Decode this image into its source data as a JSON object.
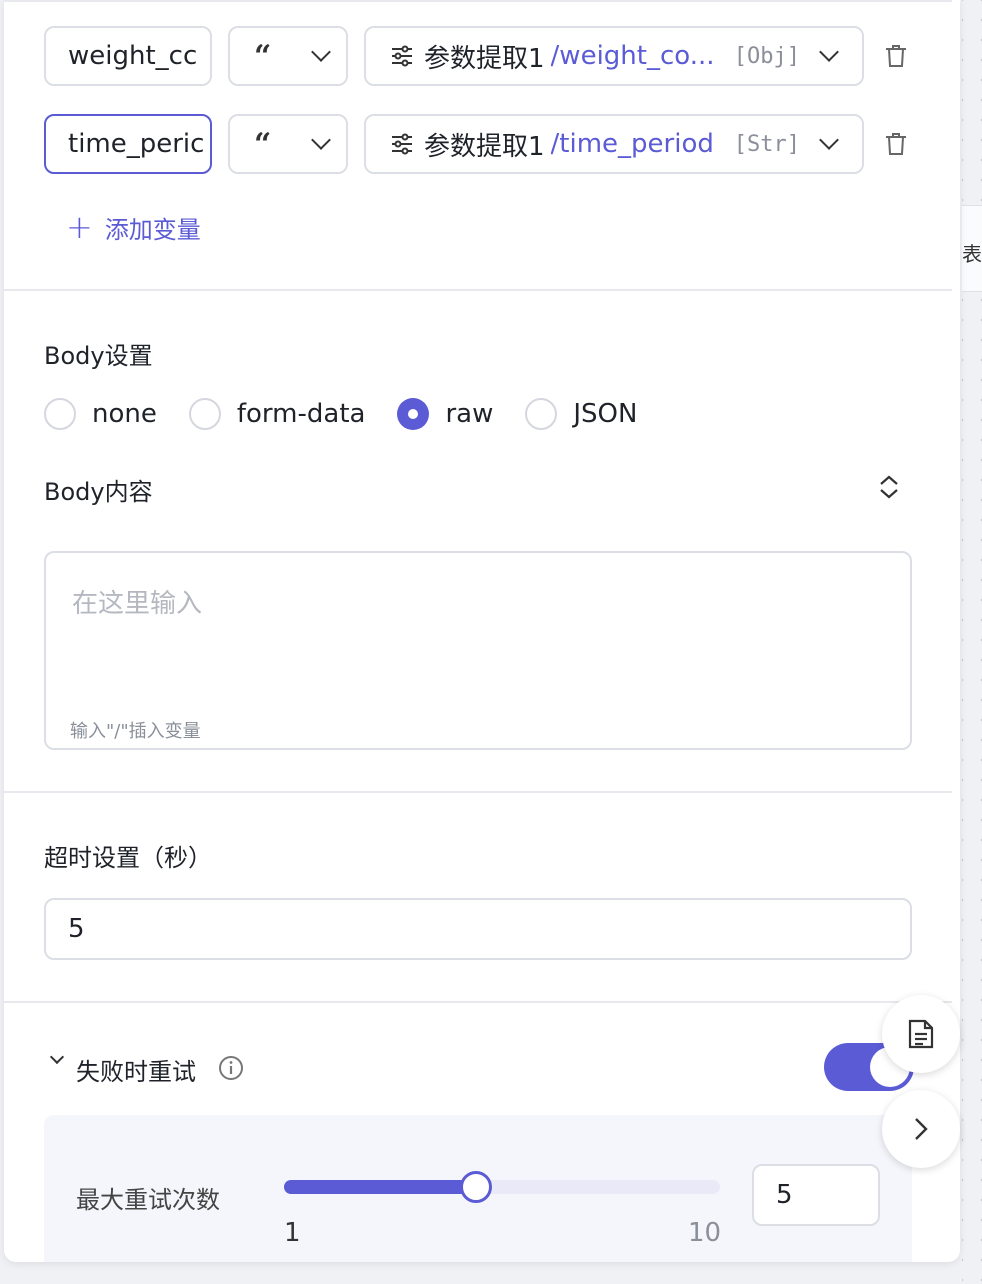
{
  "variables": [
    {
      "name": "weight_cc",
      "type_icon": "quote-icon",
      "source_label": "参数提取1",
      "source_path": "/weight_co...",
      "source_type": "[Obj]"
    },
    {
      "name": "time_peric",
      "type_icon": "quote-icon",
      "source_label": "参数提取1",
      "source_path": "/time_period",
      "source_type": "[Str]"
    }
  ],
  "add_variable_label": "添加变量",
  "body_settings": {
    "title": "Body设置",
    "options": [
      "none",
      "form-data",
      "raw",
      "JSON"
    ],
    "selected": "raw"
  },
  "body_content": {
    "title": "Body内容",
    "placeholder": "在这里输入",
    "hint": "输入\"/\"插入变量"
  },
  "timeout": {
    "title": "超时设置（秒）",
    "value": "5"
  },
  "retry": {
    "title": "失败时重试",
    "enabled": true,
    "max_label": "最大重试次数",
    "min": "1",
    "max": "10",
    "value": "5",
    "slider_fraction": 0.44
  },
  "colors": {
    "accent": "#5b5bd6"
  },
  "background_strip_text": "表"
}
